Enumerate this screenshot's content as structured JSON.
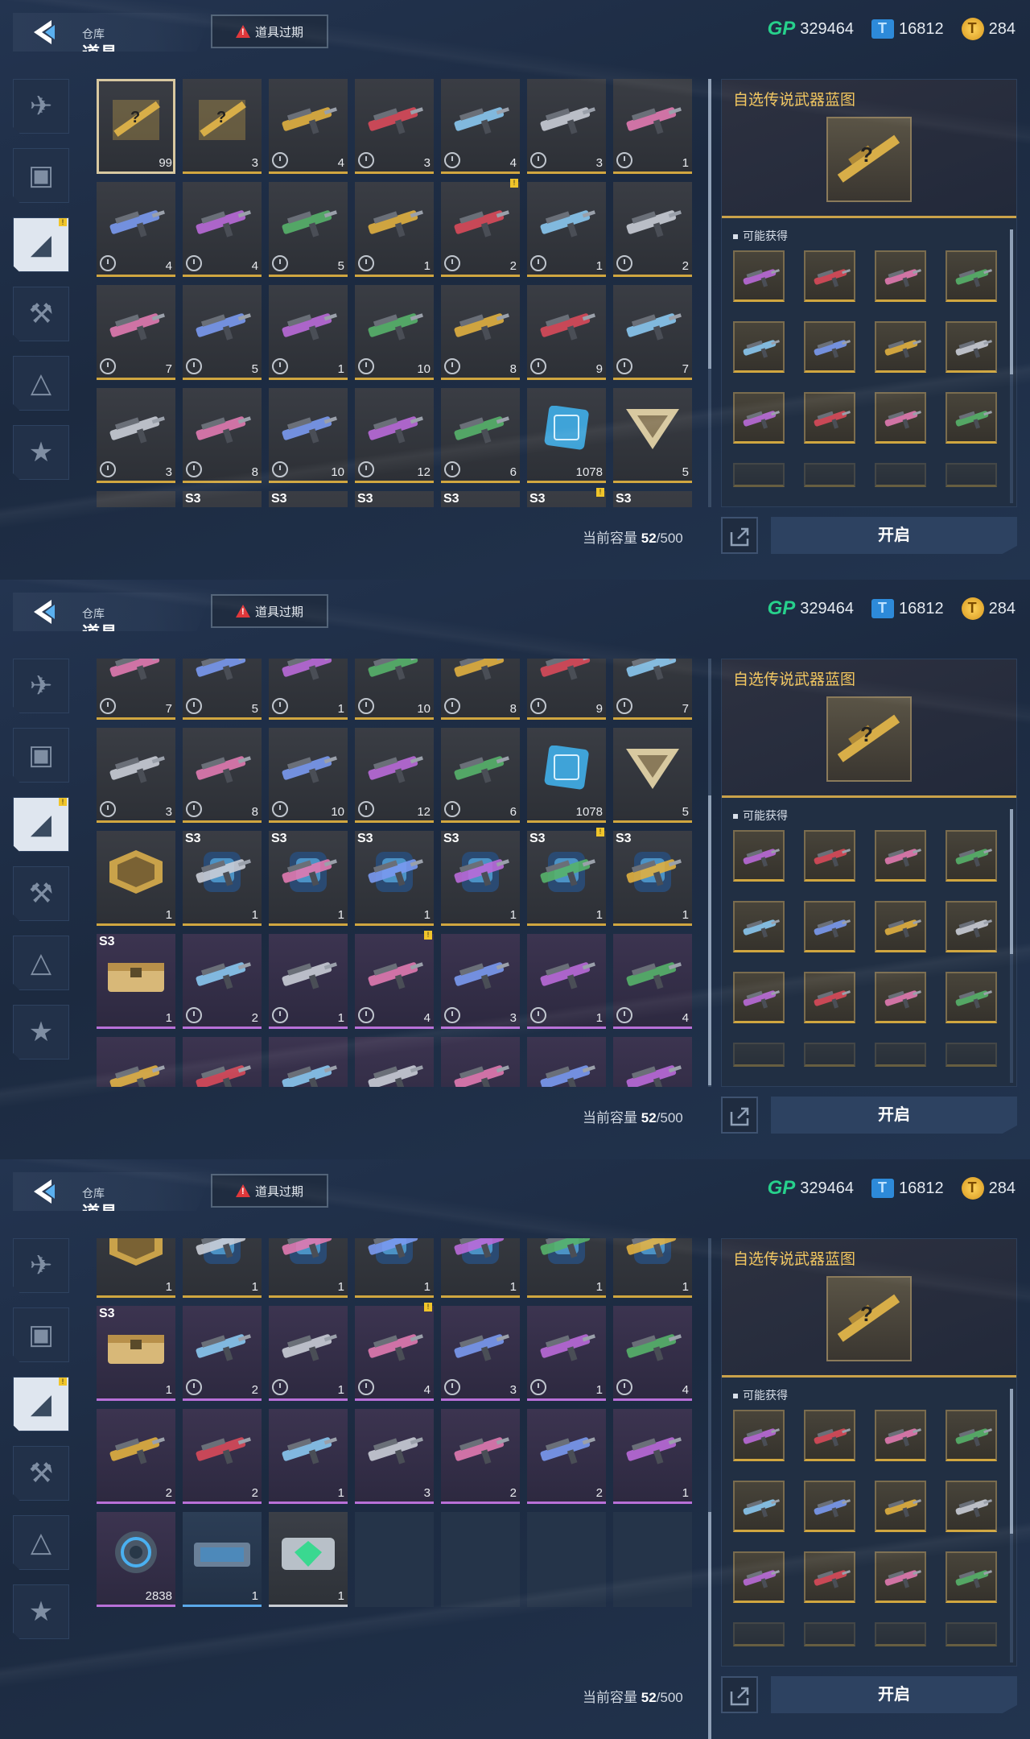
{
  "header": {
    "subtitle": "仓库",
    "title": "道具",
    "expire_label": "道具过期"
  },
  "currency": {
    "gp_label": "GP",
    "gp": "329464",
    "tickets": "16812",
    "coins": "284"
  },
  "sidebar": {
    "tabs": [
      "pistol-icon",
      "card-icon",
      "tag-icon",
      "gun-icon",
      "blueprint-icon",
      "star-badge-icon"
    ],
    "active": 2
  },
  "capacity": {
    "label": "当前容量",
    "used": "52",
    "total": "/500"
  },
  "detail": {
    "title": "自选传说武器蓝图",
    "obtain_label": "可能获得"
  },
  "buttons": {
    "open": "开启"
  },
  "rows": [
    [
      {
        "c": "99",
        "t": "gold",
        "k": "bp",
        "sel": true
      },
      {
        "c": "3",
        "t": "gold",
        "k": "bp"
      },
      {
        "c": "4",
        "t": "gold",
        "k": "gun",
        "clk": true
      },
      {
        "c": "3",
        "t": "gold",
        "k": "gun",
        "clk": true
      },
      {
        "c": "4",
        "t": "gold",
        "k": "gun",
        "clk": true
      },
      {
        "c": "3",
        "t": "gold",
        "k": "gun",
        "clk": true
      },
      {
        "c": "1",
        "t": "gold",
        "k": "gun",
        "clk": true
      }
    ],
    [
      {
        "c": "4",
        "t": "gold",
        "k": "gun",
        "clk": true
      },
      {
        "c": "4",
        "t": "gold",
        "k": "gun",
        "clk": true
      },
      {
        "c": "5",
        "t": "gold",
        "k": "gun",
        "clk": true
      },
      {
        "c": "1",
        "t": "gold",
        "k": "gun",
        "clk": true
      },
      {
        "c": "2",
        "t": "gold",
        "k": "gun",
        "clk": true,
        "m": true
      },
      {
        "c": "1",
        "t": "gold",
        "k": "gun",
        "clk": true
      },
      {
        "c": "2",
        "t": "gold",
        "k": "gun",
        "clk": true
      }
    ],
    [
      {
        "c": "7",
        "t": "gold",
        "k": "gun",
        "clk": true
      },
      {
        "c": "5",
        "t": "gold",
        "k": "gun",
        "clk": true
      },
      {
        "c": "1",
        "t": "gold",
        "k": "gun",
        "clk": true
      },
      {
        "c": "10",
        "t": "gold",
        "k": "gun",
        "clk": true
      },
      {
        "c": "8",
        "t": "gold",
        "k": "gun",
        "clk": true
      },
      {
        "c": "9",
        "t": "gold",
        "k": "gun",
        "clk": true
      },
      {
        "c": "7",
        "t": "gold",
        "k": "gun",
        "clk": true
      }
    ],
    [
      {
        "c": "3",
        "t": "gold",
        "k": "gun",
        "clk": true
      },
      {
        "c": "8",
        "t": "gold",
        "k": "gun",
        "clk": true
      },
      {
        "c": "10",
        "t": "gold",
        "k": "gun",
        "clk": true
      },
      {
        "c": "12",
        "t": "gold",
        "k": "gun",
        "clk": true
      },
      {
        "c": "6",
        "t": "gold",
        "k": "gun",
        "clk": true
      },
      {
        "c": "1078",
        "t": "gold",
        "k": "chip"
      },
      {
        "c": "5",
        "t": "gold",
        "k": "tri"
      }
    ],
    [
      {
        "c": "1",
        "t": "gold",
        "k": "hex"
      },
      {
        "c": "1",
        "t": "gold",
        "k": "pack",
        "s3": "S3"
      },
      {
        "c": "1",
        "t": "gold",
        "k": "pack",
        "s3": "S3"
      },
      {
        "c": "1",
        "t": "gold",
        "k": "pack",
        "s3": "S3"
      },
      {
        "c": "1",
        "t": "gold",
        "k": "pack",
        "s3": "S3"
      },
      {
        "c": "1",
        "t": "gold",
        "k": "pack",
        "s3": "S3",
        "m": true
      },
      {
        "c": "1",
        "t": "gold",
        "k": "pack",
        "s3": "S3"
      }
    ],
    [
      {
        "c": "1",
        "t": "purple",
        "k": "box",
        "s3": "S3"
      },
      {
        "c": "2",
        "t": "purple",
        "k": "gun",
        "clk": true
      },
      {
        "c": "1",
        "t": "purple",
        "k": "gun",
        "clk": true
      },
      {
        "c": "4",
        "t": "purple",
        "k": "gun",
        "clk": true,
        "m": true
      },
      {
        "c": "3",
        "t": "purple",
        "k": "gun",
        "clk": true
      },
      {
        "c": "1",
        "t": "purple",
        "k": "gun",
        "clk": true
      },
      {
        "c": "4",
        "t": "purple",
        "k": "gun",
        "clk": true
      }
    ],
    [
      {
        "c": "2",
        "t": "purple",
        "k": "gun"
      },
      {
        "c": "2",
        "t": "purple",
        "k": "gun"
      },
      {
        "c": "1",
        "t": "purple",
        "k": "gun"
      },
      {
        "c": "3",
        "t": "purple",
        "k": "gun"
      },
      {
        "c": "2",
        "t": "purple",
        "k": "gun"
      },
      {
        "c": "2",
        "t": "purple",
        "k": "gun"
      },
      {
        "c": "1",
        "t": "purple",
        "k": "gun"
      }
    ],
    [
      {
        "c": "2838",
        "t": "purple",
        "k": "ring"
      },
      {
        "c": "1",
        "t": "blue",
        "k": "case"
      },
      {
        "c": "1",
        "t": "white",
        "k": "gem"
      },
      {
        "t": "empty"
      },
      {
        "t": "empty"
      },
      {
        "t": "empty"
      },
      {
        "t": "empty"
      }
    ]
  ],
  "gun_colors": [
    "#b96ad8",
    "#56b26a",
    "#e0b040",
    "#d84a5a",
    "#8ac8f0",
    "#c9cdd6",
    "#e07ab0",
    "#7a9af0"
  ],
  "screens": [
    {
      "start": 0,
      "offset": 0
    },
    {
      "start": 2,
      "offset": -42
    },
    {
      "start": 4,
      "offset": -44
    }
  ]
}
